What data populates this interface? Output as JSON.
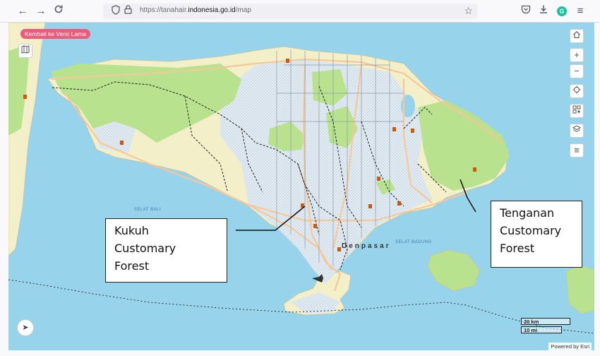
{
  "browser": {
    "url_host_prefix": "https://tanahair.",
    "url_host_bold": "indonesia.go.id",
    "url_path": "/map",
    "icons": [
      "back-icon",
      "forward-icon",
      "reload-icon",
      "shield-icon",
      "lock-icon",
      "star-icon",
      "pocket-icon",
      "download-icon",
      "grammarly-icon",
      "menu-icon"
    ],
    "grammarly_letter": "G"
  },
  "map": {
    "back_old_version": "Kembali ke Versi Lama",
    "sea_labels": {
      "selat_bali": "SELAT BALI",
      "selat_badung": "SELAT BADUNG"
    },
    "city": "Denpasar",
    "scale": {
      "km": "20 km",
      "mi": "10 mi"
    },
    "attribution": "Powered by Esri",
    "controls": [
      "home-icon",
      "zoom-in-icon",
      "zoom-out-icon",
      "locate-icon",
      "qr-icon",
      "layers-icon",
      "list-icon"
    ],
    "colors": {
      "sea": "#97d3ea",
      "land": "#f3f0c9",
      "forest": "#b8e28e",
      "urban": "#dfe7ec",
      "accent": "#ef5a7b"
    }
  },
  "annotations": {
    "kukuh": [
      "Kukuh",
      "Customary",
      "Forest"
    ],
    "tenganan": [
      "Tenganan",
      "Customary",
      "Forest"
    ]
  }
}
